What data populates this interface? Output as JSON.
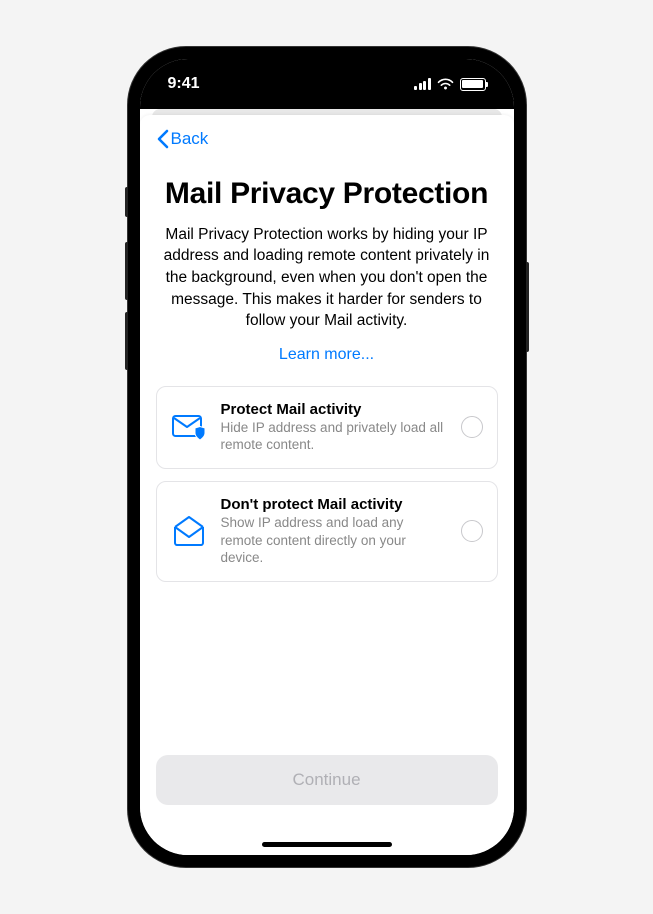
{
  "statusBar": {
    "time": "9:41"
  },
  "nav": {
    "backLabel": "Back"
  },
  "header": {
    "title": "Mail Privacy Protection",
    "description": "Mail Privacy Protection works by hiding your IP address and loading remote content privately in the background, even when you don't open the message. This makes it harder for senders to follow your Mail activity.",
    "learnMore": "Learn more..."
  },
  "options": [
    {
      "title": "Protect Mail activity",
      "subtitle": "Hide IP address and privately load all remote content."
    },
    {
      "title": "Don't protect Mail activity",
      "subtitle": "Show IP address and load any remote content directly on your device."
    }
  ],
  "footer": {
    "continueLabel": "Continue"
  }
}
